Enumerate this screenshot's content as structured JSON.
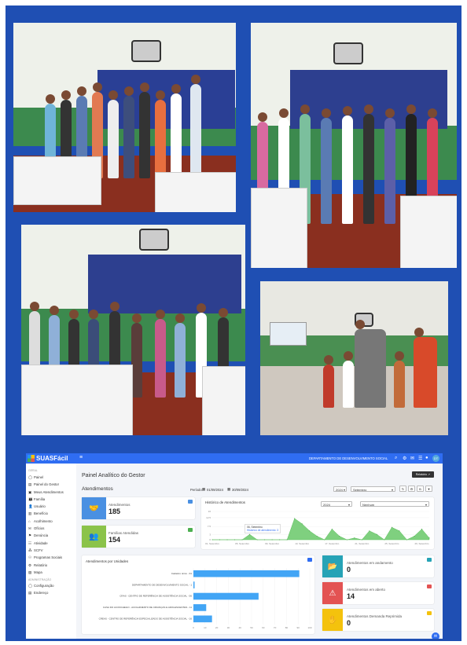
{
  "app": {
    "brand": "SUASFácil",
    "topbar_title": "DEPARTAMENTO DE DESENVOLVIMENTO SOCIAL",
    "user_badge": "DT",
    "sidebar": {
      "section_label": "GERAL",
      "items": [
        "Painel",
        "Painel do Gestor",
        "Meus Atendimentos",
        "Família",
        "Usuário",
        "Benefício",
        "Acolhimento",
        "Ofícios",
        "Denúncia",
        "Atividade",
        "SCFV",
        "Programas Sociais",
        "Relatório",
        "Mapa"
      ],
      "section2_label": "ADMINISTRAÇÃO",
      "items2": [
        "Configuração",
        "Endereço"
      ]
    },
    "page_title": "Painel Analítico do Gestor",
    "report_button": "Relatório",
    "section_title": "Atendimentos",
    "period_label": "Período:",
    "period_start": "01/09/2024",
    "period_end": "30/09/2024",
    "year_select": "2024",
    "month_select": "Setembro",
    "kpis": [
      {
        "label": "Atendimentos",
        "value": "185"
      },
      {
        "label": "Famílias Atendidas",
        "value": "154"
      }
    ],
    "history": {
      "title": "Histórico de Atendimentos",
      "year": "2024",
      "filter": "Nenhum",
      "tooltip_date": "06, Setembro",
      "tooltip_text": "Histórico de atendimento: 3"
    },
    "status_cards": [
      {
        "label": "Atendimentos em andamento",
        "value": "0"
      },
      {
        "label": "Atendimentos em aberto",
        "value": "14"
      },
      {
        "label": "Atendimentos Demanda Reprimida",
        "value": "0"
      }
    ],
    "by_unit": {
      "title": "Atendimentos por Unidades"
    }
  },
  "chart_data": [
    {
      "type": "area",
      "title": "Histórico de Atendimentos",
      "x_tick_labels": [
        "01, Setembro",
        "05, Setembro",
        "09, Setembro",
        "13, Setembro",
        "17, Setembro",
        "21, Setembro",
        "25, Setembro",
        "29, Setembro"
      ],
      "y_tick_labels": [
        "0",
        "3",
        "7.5",
        "12.5",
        "16"
      ],
      "ylim": [
        0,
        16
      ],
      "x": [
        1,
        2,
        3,
        4,
        5,
        6,
        7,
        8,
        9,
        10,
        11,
        12,
        13,
        14,
        15,
        16,
        17,
        18,
        19,
        20,
        21,
        22,
        23,
        24,
        25,
        26,
        27,
        28,
        29,
        30
      ],
      "values": [
        0,
        0,
        0,
        0,
        0,
        3,
        0,
        0,
        0,
        0,
        0,
        12,
        9,
        5,
        2,
        0,
        6,
        2,
        0,
        1,
        0,
        5,
        3,
        0,
        7,
        5,
        0,
        2,
        6,
        1
      ],
      "grid": true
    },
    {
      "type": "bar",
      "orientation": "horizontal",
      "title": "Atendimentos por Unidades",
      "categories": [
        "Cadastro único - 91",
        "DEPARTAMENTO DE DESENVOLVIMENTO SOCIAL - 1",
        "CRAS - CENTRO DE REFERÊNCIA DE ASSISTÊNCIA SOCIAL - 56",
        "CASA DO ACONCHEGO - ACOLHIMENTO DE CRIANÇAS E ADOLESCENTES - 11",
        "CREAS - CENTRO DE REFERÊNCIA ESPECIALIZADO DE ASSISTÊNCIA SOCIAL - 16"
      ],
      "values": [
        91,
        1,
        56,
        11,
        16
      ],
      "x_tick_labels": [
        "0",
        "10",
        "20",
        "30",
        "40",
        "50",
        "60",
        "70",
        "80",
        "90",
        "100"
      ],
      "xlim": [
        0,
        100
      ],
      "color": "#42a5f5"
    }
  ],
  "colors": {
    "frame": "#1f4fb3",
    "topbar": "#2f6df2",
    "kpi_blue": "#4a90e2",
    "kpi_green": "#8bc34a",
    "teal": "#26a3b6",
    "red": "#e35353",
    "yellow": "#f4c20d",
    "history_fill": "#7fd07f"
  }
}
